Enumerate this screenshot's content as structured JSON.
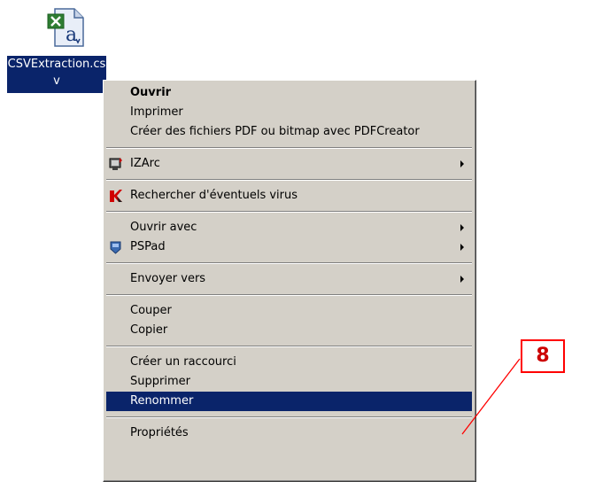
{
  "desktop_file": {
    "label": "CSVExtraction.csv",
    "icon": "excel-csv-file-icon"
  },
  "context_menu": {
    "groups": [
      [
        {
          "label": "Ouvrir",
          "bold": true
        },
        {
          "label": "Imprimer"
        },
        {
          "label": "Créer des fichiers PDF ou bitmap avec PDFCreator"
        }
      ],
      [
        {
          "label": "IZArc",
          "icon": "izarc-icon",
          "submenu": true
        }
      ],
      [
        {
          "label": "Rechercher d'éventuels virus",
          "icon": "antivirus-icon"
        }
      ],
      [
        {
          "label": "Ouvrir avec",
          "submenu": true
        },
        {
          "label": "PSPad",
          "icon": "pspad-icon",
          "submenu": true
        }
      ],
      [
        {
          "label": "Envoyer vers",
          "submenu": true
        }
      ],
      [
        {
          "label": "Couper"
        },
        {
          "label": "Copier"
        }
      ],
      [
        {
          "label": "Créer un raccourci"
        },
        {
          "label": "Supprimer"
        },
        {
          "label": "Renommer",
          "selected": true
        }
      ],
      [
        {
          "label": "Propriétés"
        }
      ]
    ]
  },
  "annotation": {
    "label": "8",
    "color": "#ff0000"
  },
  "colors": {
    "menu_bg": "#d4d0c8",
    "selection": "#0a246a"
  }
}
